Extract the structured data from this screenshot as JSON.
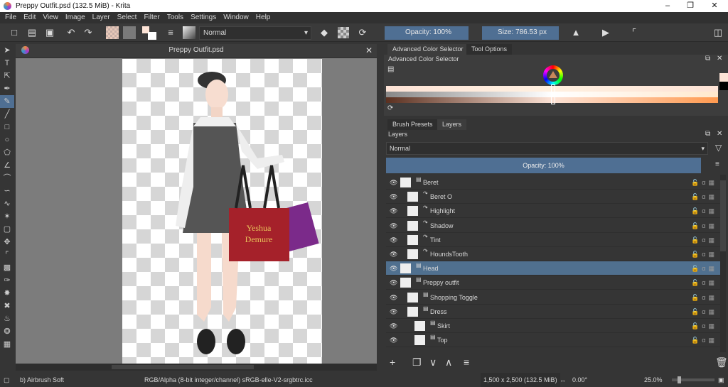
{
  "window": {
    "title": "Preppy Outfit.psd (132.5 MiB)  - Krita"
  },
  "menu": [
    "File",
    "Edit",
    "View",
    "Image",
    "Layer",
    "Select",
    "Filter",
    "Tools",
    "Settings",
    "Window",
    "Help"
  ],
  "toolbar": {
    "blend_mode": "Normal",
    "opacity": "Opacity: 100%",
    "size": "Size: 786.53 px"
  },
  "document": {
    "title": "Preppy Outfit.psd",
    "art_text": [
      "Yeshua",
      "Demure"
    ]
  },
  "color_panel": {
    "tabs": [
      "Advanced Color Selector",
      "Tool Options"
    ],
    "header": "Advanced Color Selector",
    "fg_color": "#fde3d6",
    "accent": "#4f6f93"
  },
  "layers_panel": {
    "tabs": [
      "Brush Presets",
      "Layers"
    ],
    "header": "Layers",
    "blend_mode": "Normal",
    "opacity": "Opacity:  100%",
    "layers": [
      {
        "name": "Beret",
        "depth": 0,
        "type": "group",
        "selected": false
      },
      {
        "name": "Beret O",
        "depth": 1,
        "type": "clone",
        "selected": false
      },
      {
        "name": "Highlight",
        "depth": 1,
        "type": "clone",
        "selected": false
      },
      {
        "name": "Shadow",
        "depth": 1,
        "type": "clone",
        "selected": false
      },
      {
        "name": "Tint",
        "depth": 1,
        "type": "clone",
        "selected": false
      },
      {
        "name": "HoundsTooth",
        "depth": 1,
        "type": "clone",
        "selected": false
      },
      {
        "name": "Head",
        "depth": 0,
        "type": "group",
        "selected": true
      },
      {
        "name": "Preppy outfit",
        "depth": 0,
        "type": "group",
        "selected": false
      },
      {
        "name": "Shopping Toggle",
        "depth": 1,
        "type": "group",
        "selected": false
      },
      {
        "name": "Dress",
        "depth": 1,
        "type": "group",
        "selected": false
      },
      {
        "name": "Skirt",
        "depth": 2,
        "type": "group",
        "selected": false
      },
      {
        "name": "Top",
        "depth": 2,
        "type": "group",
        "selected": false
      }
    ]
  },
  "status": {
    "brush": "b) Airbrush Soft",
    "color_space": "RGB/Alpha (8-bit integer/channel)  sRGB-elle-V2-srgbtrc.icc",
    "dimensions": "1,500 x 2,500 (132.5 MiB)",
    "rotation": "0.00°",
    "zoom": "25.0%"
  }
}
